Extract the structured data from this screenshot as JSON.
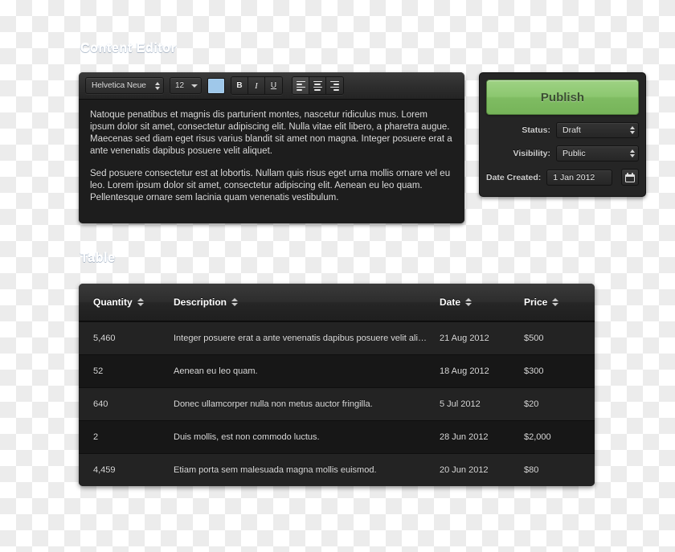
{
  "sections": {
    "editor_heading": "Content Editor",
    "table_heading": "Table"
  },
  "editor": {
    "toolbar": {
      "font_family": "Helvetica Neue",
      "font_size": "12",
      "color_swatch": "#9fc8ea",
      "bold_label": "B",
      "italic_label": "I",
      "underline_label": "U",
      "align_left_name": "align-left",
      "align_center_name": "align-center",
      "align_right_name": "align-right"
    },
    "paragraphs": [
      "Natoque penatibus et magnis dis parturient montes, nascetur ridiculus mus. Lorem ipsum dolor sit amet, consectetur adipiscing elit. Nulla vitae elit libero, a pharetra augue. Maecenas sed diam eget risus varius blandit sit amet non magna. Integer posuere erat a ante venenatis dapibus posuere velit aliquet.",
      "Sed posuere consectetur est at lobortis. Nullam quis risus eget urna mollis ornare vel eu leo. Lorem ipsum dolor sit amet, consectetur adipiscing elit. Aenean eu leo quam. Pellentesque ornare sem lacinia quam venenatis vestibulum."
    ]
  },
  "publish": {
    "button_label": "Publish",
    "button_color": "#8cc76f",
    "fields": [
      {
        "label": "Status:",
        "value": "Draft"
      },
      {
        "label": "Visibility:",
        "value": "Public"
      },
      {
        "label": "Date Created:",
        "value": "1 Jan 2012"
      }
    ]
  },
  "table": {
    "columns": [
      {
        "label": "Quantity"
      },
      {
        "label": "Description"
      },
      {
        "label": "Date"
      },
      {
        "label": "Price"
      }
    ],
    "rows": [
      {
        "quantity": "5,460",
        "description": "Integer posuere erat a ante venenatis dapibus posuere velit aliquet.",
        "date": "21 Aug 2012",
        "price": "$500"
      },
      {
        "quantity": "52",
        "description": "Aenean eu leo quam.",
        "date": "18 Aug 2012",
        "price": "$300"
      },
      {
        "quantity": "640",
        "description": "Donec ullamcorper nulla non metus auctor fringilla.",
        "date": "5 Jul 2012",
        "price": "$20"
      },
      {
        "quantity": "2",
        "description": "Duis mollis, est non commodo luctus.",
        "date": "28 Jun 2012",
        "price": "$2,000"
      },
      {
        "quantity": "4,459",
        "description": "Etiam porta sem malesuada magna mollis euismod.",
        "date": "20 Jun 2012",
        "price": "$80"
      }
    ]
  }
}
